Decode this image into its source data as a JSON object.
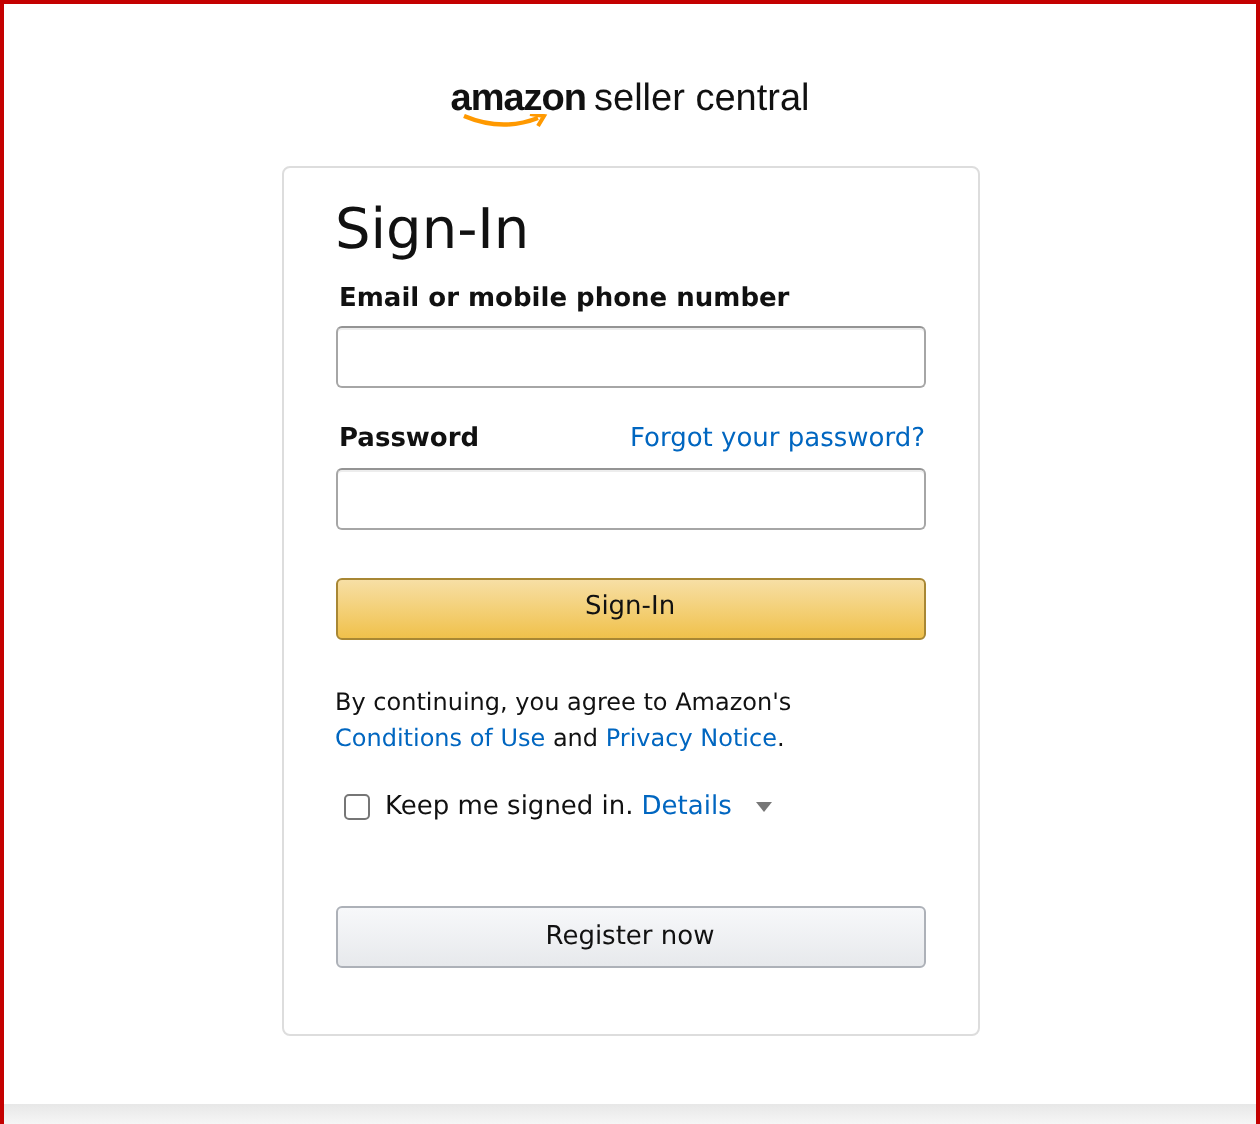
{
  "logo": {
    "brand": "amazon",
    "product": "seller central"
  },
  "title": "Sign-In",
  "fields": [
    {
      "label": "Email or mobile phone number"
    },
    {
      "label": "Password",
      "link": "Forgot your password?"
    }
  ],
  "submit": "Sign-In",
  "terms": [
    {
      "kind": "text",
      "text": "By continuing, you agree to Amazon's "
    },
    {
      "kind": "link",
      "text": "Conditions of Use"
    },
    {
      "kind": "text",
      "text": " and "
    },
    {
      "kind": "link",
      "text": "Privacy Notice"
    },
    {
      "kind": "text",
      "text": "."
    }
  ],
  "keep_signed_in": {
    "label": "Keep me signed in.",
    "link": "Details",
    "checked": false
  },
  "register": "Register now"
}
